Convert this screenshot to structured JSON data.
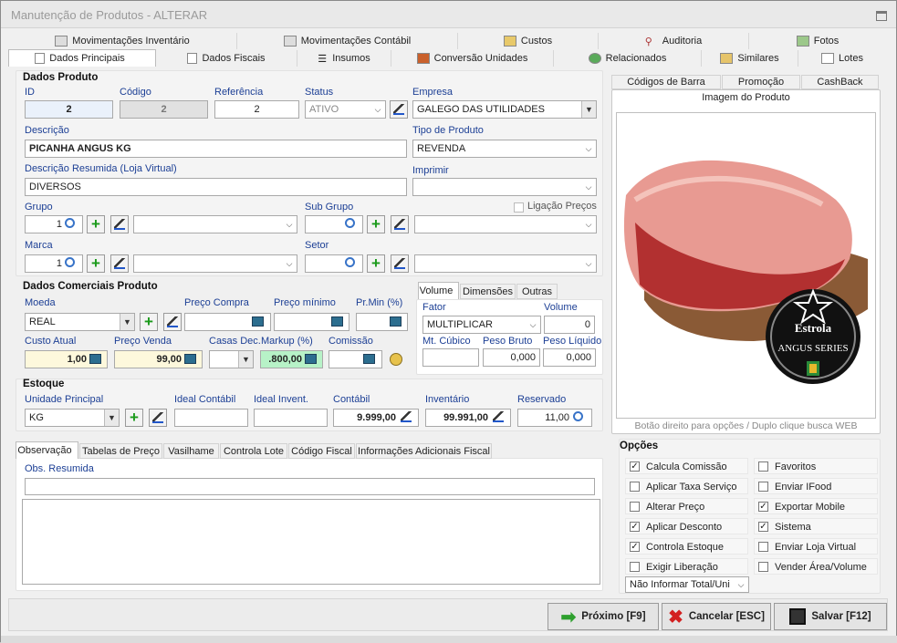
{
  "window": {
    "title": "Manutenção  de Produtos - ALTERAR"
  },
  "top_tabs": [
    "Movimentações Inventário",
    "Movimentações Contábil",
    "Custos",
    "Auditoria",
    "Fotos"
  ],
  "main_tabs": [
    "Dados Principais",
    "Dados Fiscais",
    "Insumos",
    "Conversão Unidades",
    "Relacionados",
    "Similares",
    "Lotes"
  ],
  "dados_produto": {
    "section": "Dados Produto",
    "id_label": "ID",
    "id": "2",
    "codigo_label": "Código",
    "codigo": "2",
    "referencia_label": "Referência",
    "referencia": "2",
    "status_label": "Status",
    "status": "ATIVO",
    "empresa_label": "Empresa",
    "empresa": "GALEGO DAS UTILIDADES",
    "descricao_label": "Descrição",
    "descricao": "PICANHA ANGUS KG",
    "tipo_label": "Tipo de Produto",
    "tipo": "REVENDA",
    "desc_resumida_label": "Descrição Resumida (Loja Virtual)",
    "desc_resumida": "DIVERSOS",
    "imprimir_label": "Imprimir",
    "imprimir": "",
    "grupo_label": "Grupo",
    "grupo": "1",
    "subgrupo_label": "Sub Grupo",
    "subgrupo": "",
    "ligacao_label": "Ligação Preços",
    "marca_label": "Marca",
    "marca": "1",
    "setor_label": "Setor",
    "setor": ""
  },
  "comerciais": {
    "section": "Dados Comerciais Produto",
    "moeda_label": "Moeda",
    "moeda": "REAL",
    "preco_compra_label": "Preço Compra",
    "preco_compra": "",
    "preco_minimo_label": "Preço mínimo",
    "preco_minimo": "",
    "prmin_label": "Pr.Min (%)",
    "prmin": "",
    "custo_label": "Custo Atual",
    "custo": "1,00",
    "preco_venda_label": "Preço Venda",
    "preco_venda": "99,00",
    "casas_label": "Casas Dec.",
    "casas": "",
    "markup_label": "Markup (%)",
    "markup": ".800,00",
    "comissao_label": "Comissão",
    "comissao": ""
  },
  "volume": {
    "tabs": [
      "Volume",
      "Dimensões",
      "Outras"
    ],
    "fator_label": "Fator",
    "fator": "MULTIPLICAR",
    "volume_label": "Volume",
    "volume": "0",
    "cubico_label": "Mt. Cúbico",
    "cubico": "",
    "bruto_label": "Peso Bruto",
    "bruto": "0,000",
    "liquido_label": "Peso Líquido",
    "liquido": "0,000"
  },
  "estoque": {
    "section": "Estoque",
    "unidade_label": "Unidade Principal",
    "unidade": "KG",
    "ideal_contabil_label": "Ideal Contábil",
    "ideal_contabil": "",
    "ideal_invent_label": "Ideal Invent.",
    "ideal_invent": "",
    "contabil_label": "Contábil",
    "contabil": "9.999,00",
    "inventario_label": "Inventário",
    "inventario": "99.991,00",
    "reservado_label": "Reservado",
    "reservado": "11,00"
  },
  "bottom_tabs": [
    "Observação",
    "Tabelas de Preço",
    "Vasilhame",
    "Controla Lote",
    "Código Fiscal",
    "Informações Adicionais Fiscal"
  ],
  "obs": {
    "label": "Obs. Resumida",
    "value": ""
  },
  "image_panel": {
    "tabs": [
      "Códigos de Barra",
      "Promoção",
      "CashBack"
    ],
    "title": "Imagem do Produto",
    "hint": "Botão direito para opções / Duplo clique busca WEB",
    "logo_lines": [
      "Estrola",
      "ANGUS SERIES"
    ]
  },
  "opcoes": {
    "title": "Opções",
    "left": [
      {
        "label": "Calcula Comissão",
        "checked": true
      },
      {
        "label": "Aplicar Taxa Serviço",
        "checked": false
      },
      {
        "label": "Alterar Preço",
        "checked": false
      },
      {
        "label": "Aplicar Desconto",
        "checked": true
      },
      {
        "label": "Controla Estoque",
        "checked": true
      },
      {
        "label": "Exigir Liberação",
        "checked": false
      }
    ],
    "right": [
      {
        "label": "Favoritos",
        "checked": false
      },
      {
        "label": "Enviar IFood",
        "checked": false
      },
      {
        "label": "Exportar Mobile",
        "checked": true
      },
      {
        "label": "Sistema",
        "checked": true
      },
      {
        "label": "Enviar Loja Virtual",
        "checked": false
      },
      {
        "label": "Vender Área/Volume",
        "checked": false
      }
    ],
    "total_select": "Não Informar Total/Uni"
  },
  "buttons": {
    "proximo": "Próximo [F9]",
    "cancelar": "Cancelar [ESC]",
    "salvar": "Salvar [F12]"
  }
}
